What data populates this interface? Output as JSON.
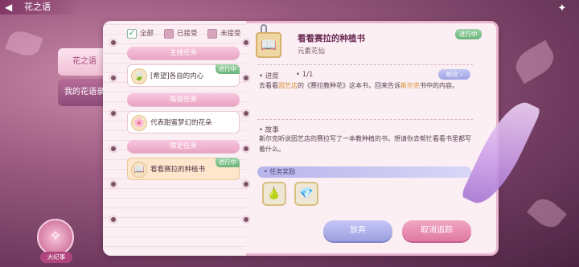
{
  "header": {
    "title": "花之语",
    "back_icon": "back-arrow-icon",
    "corner_icon": "flower-star-icon"
  },
  "side_tabs": [
    {
      "label": "花之语",
      "active": true
    },
    {
      "label": "我的花语录",
      "active": false
    }
  ],
  "filters": [
    {
      "label": "全部",
      "checked": true
    },
    {
      "label": "已接受",
      "checked": false
    },
    {
      "label": "未接受",
      "checked": false
    }
  ],
  "categories": {
    "main": "主线任务",
    "daily": "每级任务",
    "limited": "限定任务"
  },
  "quests": [
    {
      "title": "[希望]各自的内心",
      "status": "进行中",
      "icon": "🍃"
    },
    {
      "title": "代表甜蜜梦幻的花朵",
      "status": "",
      "icon": "🌸"
    },
    {
      "title": "看看赛拉的种植书",
      "status": "进行中",
      "icon": "📖"
    }
  ],
  "detail": {
    "title": "看看赛拉的种植书",
    "subtitle": "元素花仙",
    "status": "进行中",
    "progress_label": "进度",
    "progress_value": "1/1",
    "goto_label": "前往",
    "desc_parts": [
      "去看看",
      "园艺店",
      "的《赛拉教种花》这本书，回来告诉",
      "斯尔克",
      "书中的内容。"
    ],
    "story_label": "故事",
    "story_text": "斯尔克听说园艺店的赛拉写了一本教种植的书，想请你去帮忙看看书里都写着什么。",
    "reward_label": "任务奖励",
    "rewards": [
      "🍐",
      "💎"
    ]
  },
  "buttons": {
    "abandon": "放弃",
    "untrack": "取消追踪"
  },
  "chronicle": {
    "label": "大纪事",
    "icon": "fairy-icon"
  }
}
